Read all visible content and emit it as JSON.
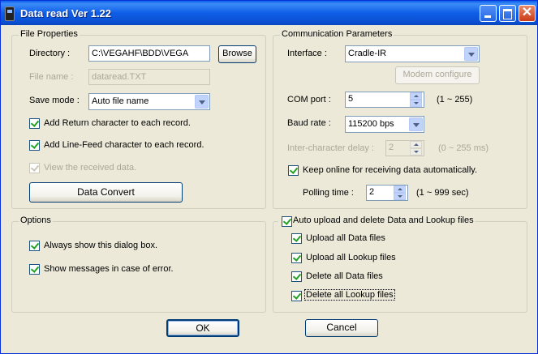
{
  "window": {
    "title": "Data read  Ver 1.22"
  },
  "file_properties": {
    "title": "File Properties",
    "directory_label": "Directory :",
    "directory_value": "C:\\VEGAHF\\BDD\\VEGA",
    "browse_label": "Browse",
    "filename_label": "File name :",
    "filename_value": "dataread.TXT",
    "save_mode_label": "Save mode :",
    "save_mode_value": "Auto file name",
    "add_return_label": "Add Return character to each record.",
    "add_linefeed_label": "Add Line-Feed character to each record.",
    "view_received_label": "View the received data.",
    "data_convert_label": "Data Convert"
  },
  "communication": {
    "title": "Communication Parameters",
    "interface_label": "Interface :",
    "interface_value": "Cradle-IR",
    "modem_configure_label": "Modem configure",
    "com_port_label": "COM port :",
    "com_port_value": "5",
    "com_port_range": "(1 ~ 255)",
    "baud_rate_label": "Baud rate :",
    "baud_rate_value": "115200 bps",
    "inter_char_label": "Inter-character delay :",
    "inter_char_value": "2",
    "inter_char_range": "(0 ~ 255 ms)",
    "keep_online_label": "Keep online for receiving data automatically.",
    "polling_label": "Polling time :",
    "polling_value": "2",
    "polling_range": "(1 ~ 999 sec)"
  },
  "options": {
    "title": "Options",
    "always_show_label": "Always show this dialog box.",
    "show_messages_label": "Show messages in case of error."
  },
  "auto_upload": {
    "title": "Auto upload and delete Data and Lookup files",
    "upload_data_label": "Upload all Data files",
    "upload_lookup_label": "Upload all Lookup files",
    "delete_data_label": "Delete all Data files",
    "delete_lookup_label": "Delete all Lookup files"
  },
  "footer": {
    "ok_label": "OK",
    "cancel_label": "Cancel"
  }
}
